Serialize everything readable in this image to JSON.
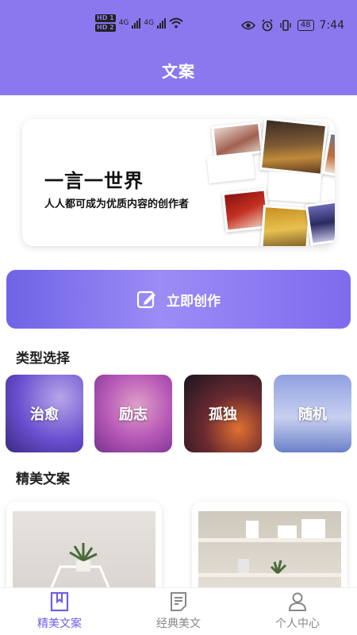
{
  "status_bar": {
    "hd1": "HD 1",
    "hd2": "HD 2",
    "net1": "4G",
    "net2": "4G",
    "battery": "48",
    "time": "7:44"
  },
  "header": {
    "title": "文案"
  },
  "banner": {
    "title": "一言一世界",
    "subtitle": "人人都可成为优质内容的创作者"
  },
  "create_button": {
    "label": "立即创作",
    "icon": "edit-icon"
  },
  "category_section": {
    "title": "类型选择",
    "items": [
      {
        "label": "治愈",
        "color": "#6a4fd0"
      },
      {
        "label": "励志",
        "color": "#b95bb8"
      },
      {
        "label": "孤独",
        "color": "#3a2a44"
      },
      {
        "label": "随机",
        "color": "#7a8fd8"
      }
    ]
  },
  "featured_section": {
    "title": "精美文案"
  },
  "tabbar": {
    "items": [
      {
        "label": "精美文案",
        "icon": "bookmark-book-icon",
        "active": true
      },
      {
        "label": "经典美文",
        "icon": "document-icon",
        "active": false
      },
      {
        "label": "个人中心",
        "icon": "user-icon",
        "active": false
      }
    ]
  },
  "colors": {
    "header": "#8b78ef",
    "accent": "#6f5fe8"
  }
}
